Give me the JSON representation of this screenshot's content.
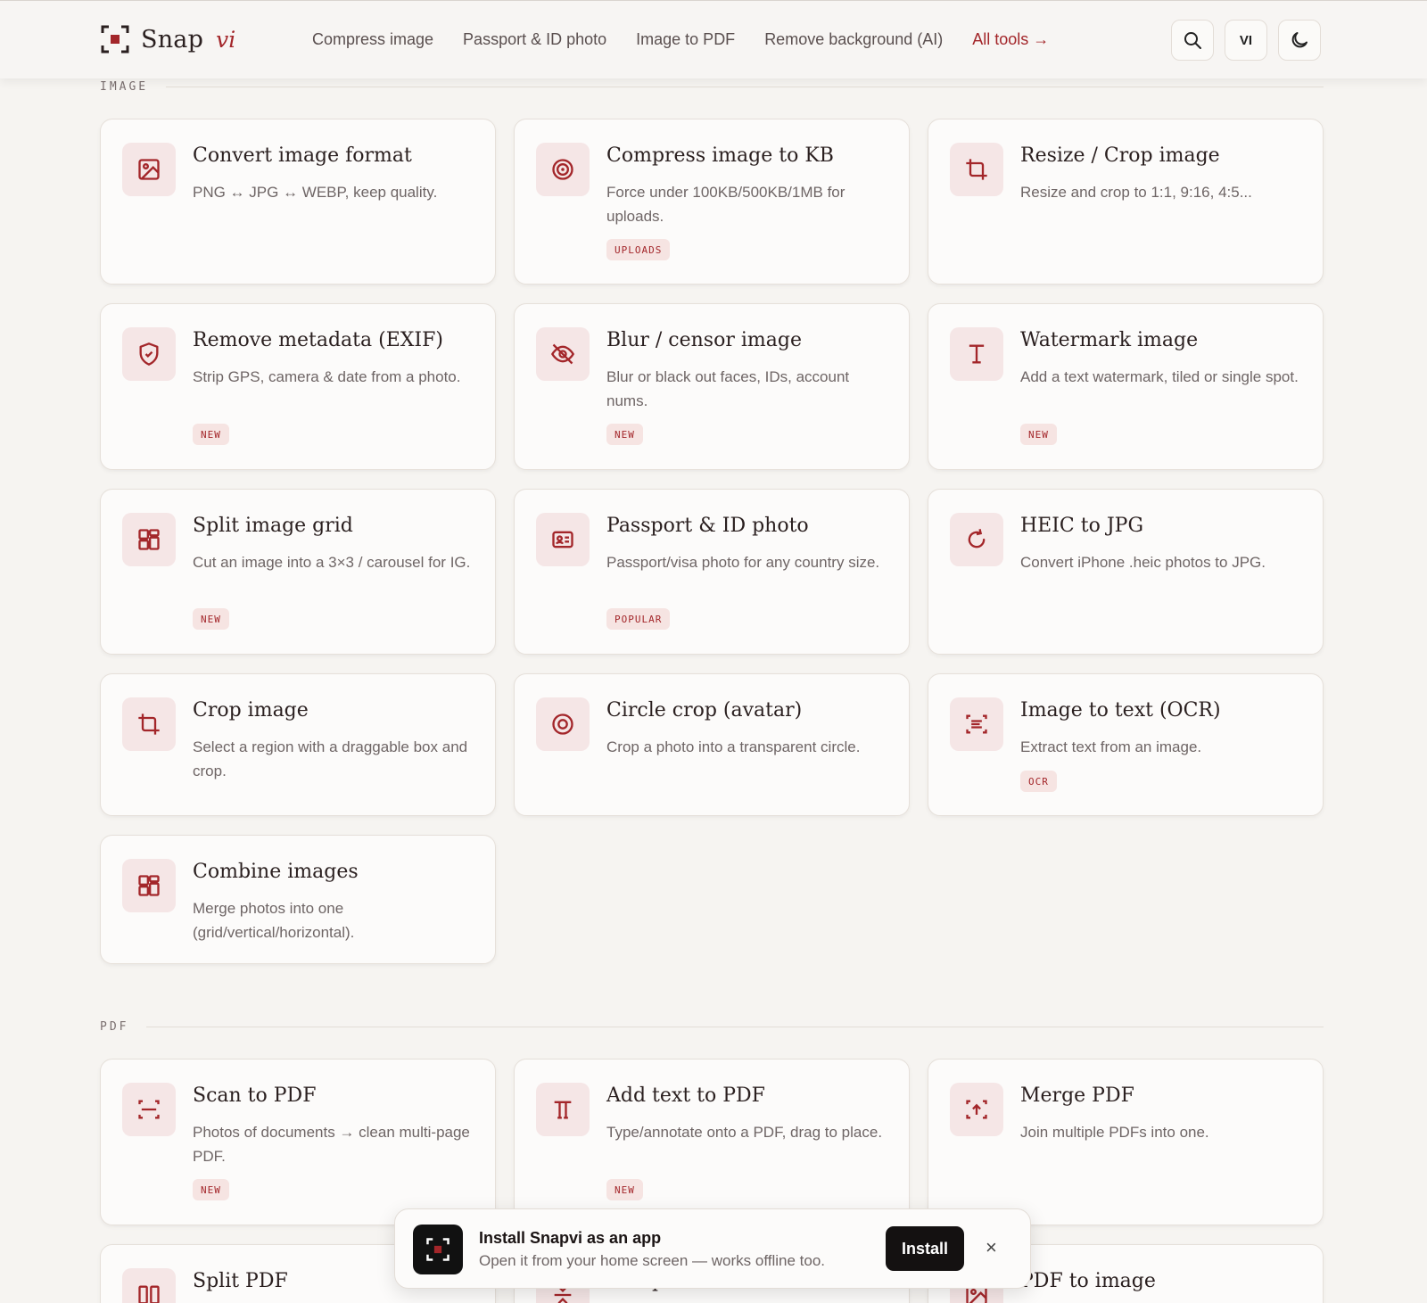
{
  "header": {
    "brand_name": "Snap",
    "brand_accent": "vi",
    "nav": [
      {
        "label": "Compress image"
      },
      {
        "label": "Passport & ID photo"
      },
      {
        "label": "Image to PDF"
      },
      {
        "label": "Remove background (AI)"
      },
      {
        "label": "All tools →"
      }
    ],
    "lang_label": "VI",
    "icons": {
      "search": "search-icon",
      "theme": "moon-icon"
    }
  },
  "colors": {
    "accent": "#a3262a",
    "badge_bg": "#f6e4e2",
    "icon_bg": "#f5e6e6",
    "page_bg": "#f6f4f1"
  },
  "sections": [
    {
      "label": "IMAGE",
      "cards": [
        {
          "title": "Convert image format",
          "desc": "PNG ↔ JPG ↔ WEBP, keep quality.",
          "icon": "image-icon"
        },
        {
          "title": "Compress image to KB",
          "desc": "Force under 100KB/500KB/1MB for uploads.",
          "badge": "UPLOADS",
          "icon": "target-icon"
        },
        {
          "title": "Resize / Crop image",
          "desc": "Resize and crop to 1:1, 9:16, 4:5...",
          "icon": "crop-icon"
        },
        {
          "title": "Remove metadata (EXIF)",
          "desc": "Strip GPS, camera & date from a photo.",
          "badge": "NEW",
          "icon": "shield-icon"
        },
        {
          "title": "Blur / censor image",
          "desc": "Blur or black out faces, IDs, account nums.",
          "badge": "NEW",
          "icon": "eye-off-icon"
        },
        {
          "title": "Watermark image",
          "desc": "Add a text watermark, tiled or single spot.",
          "badge": "NEW",
          "icon": "text-cursor-icon"
        },
        {
          "title": "Split image grid",
          "desc": "Cut an image into a 3×3 / carousel for IG.",
          "badge": "NEW",
          "icon": "grid-icon"
        },
        {
          "title": "Passport & ID photo",
          "desc": "Passport/visa photo for any country size.",
          "badge": "POPULAR",
          "icon": "id-card-icon"
        },
        {
          "title": "HEIC to JPG",
          "desc": "Convert iPhone .heic photos to JPG.",
          "icon": "refresh-icon"
        },
        {
          "title": "Crop image",
          "desc": "Select a region with a draggable box and crop.",
          "icon": "crop-icon"
        },
        {
          "title": "Circle crop (avatar)",
          "desc": "Crop a photo into a transparent circle.",
          "icon": "circle-target-icon"
        },
        {
          "title": "Image to text (OCR)",
          "desc": "Extract text from an image.",
          "badge": "OCR",
          "icon": "scan-text-icon"
        },
        {
          "title": "Combine images",
          "desc": "Merge photos into one (grid/vertical/horizontal).",
          "icon": "grid-icon"
        }
      ]
    },
    {
      "label": "PDF",
      "cards": [
        {
          "title": "Scan to PDF",
          "desc": "Photos of documents → clean multi-page PDF.",
          "badge": "NEW",
          "icon": "scan-icon"
        },
        {
          "title": "Add text to PDF",
          "desc": "Type/annotate onto a PDF, drag to place.",
          "badge": "NEW",
          "icon": "text-icon"
        },
        {
          "title": "Merge PDF",
          "desc": "Join multiple PDFs into one.",
          "icon": "merge-icon"
        },
        {
          "title": "Split PDF",
          "desc": "",
          "icon": "columns-icon"
        },
        {
          "title": "Compress PDF",
          "desc": "",
          "icon": "compress-icon"
        },
        {
          "title": "PDF to image",
          "desc": "",
          "icon": "image-icon"
        }
      ]
    }
  ],
  "install_toast": {
    "title": "Install Snapvi as an app",
    "subtitle": "Open it from your home screen — works offline too.",
    "install_label": "Install",
    "close_label": "×"
  }
}
